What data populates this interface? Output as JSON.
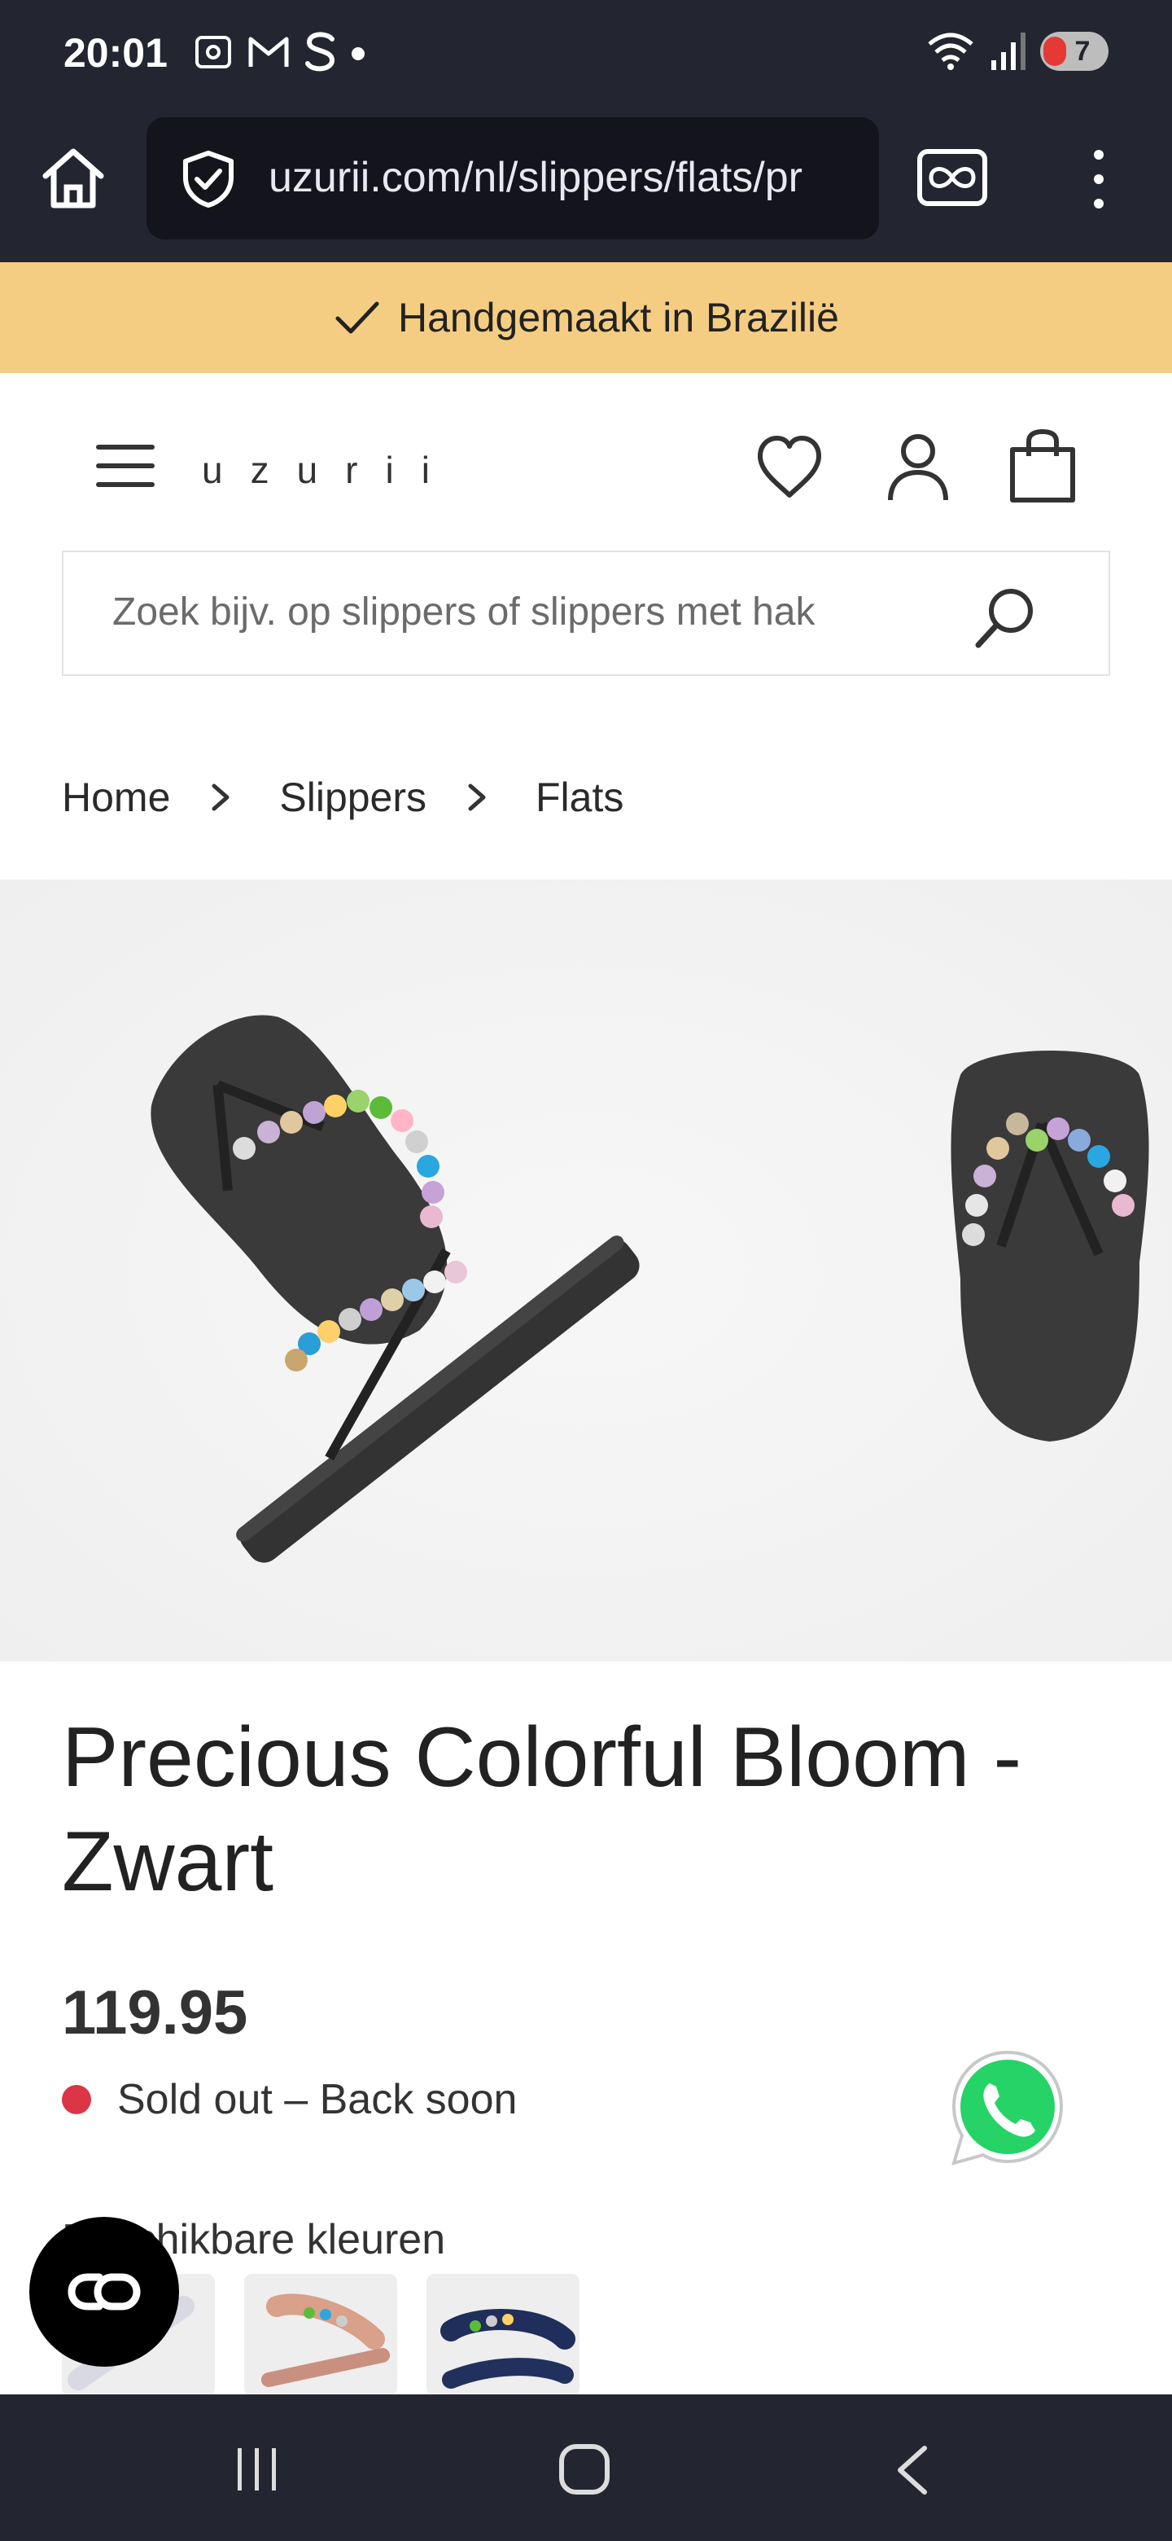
{
  "status_bar": {
    "time": "20:01",
    "battery": "7"
  },
  "browser": {
    "url": "uzurii.com/nl/slippers/flats/pr"
  },
  "promo": {
    "text": "Handgemaakt in Brazilië"
  },
  "header": {
    "logo": "uzurii"
  },
  "search": {
    "placeholder": "Zoek bijv. op slippers of slippers met hak"
  },
  "breadcrumb": {
    "items": [
      "Home",
      "Slippers",
      "Flats"
    ]
  },
  "product": {
    "title": "Precious Colorful Bloom - Zwart",
    "price": "119.95",
    "stock_status": "Sold out – Back soon",
    "colors_label": "Beschikbare kleuren",
    "stock_color": "#dc3545"
  },
  "colors": {
    "status_bar_bg": "#232530",
    "promo_bg": "#f5cd82",
    "whatsapp": "#25d366"
  }
}
